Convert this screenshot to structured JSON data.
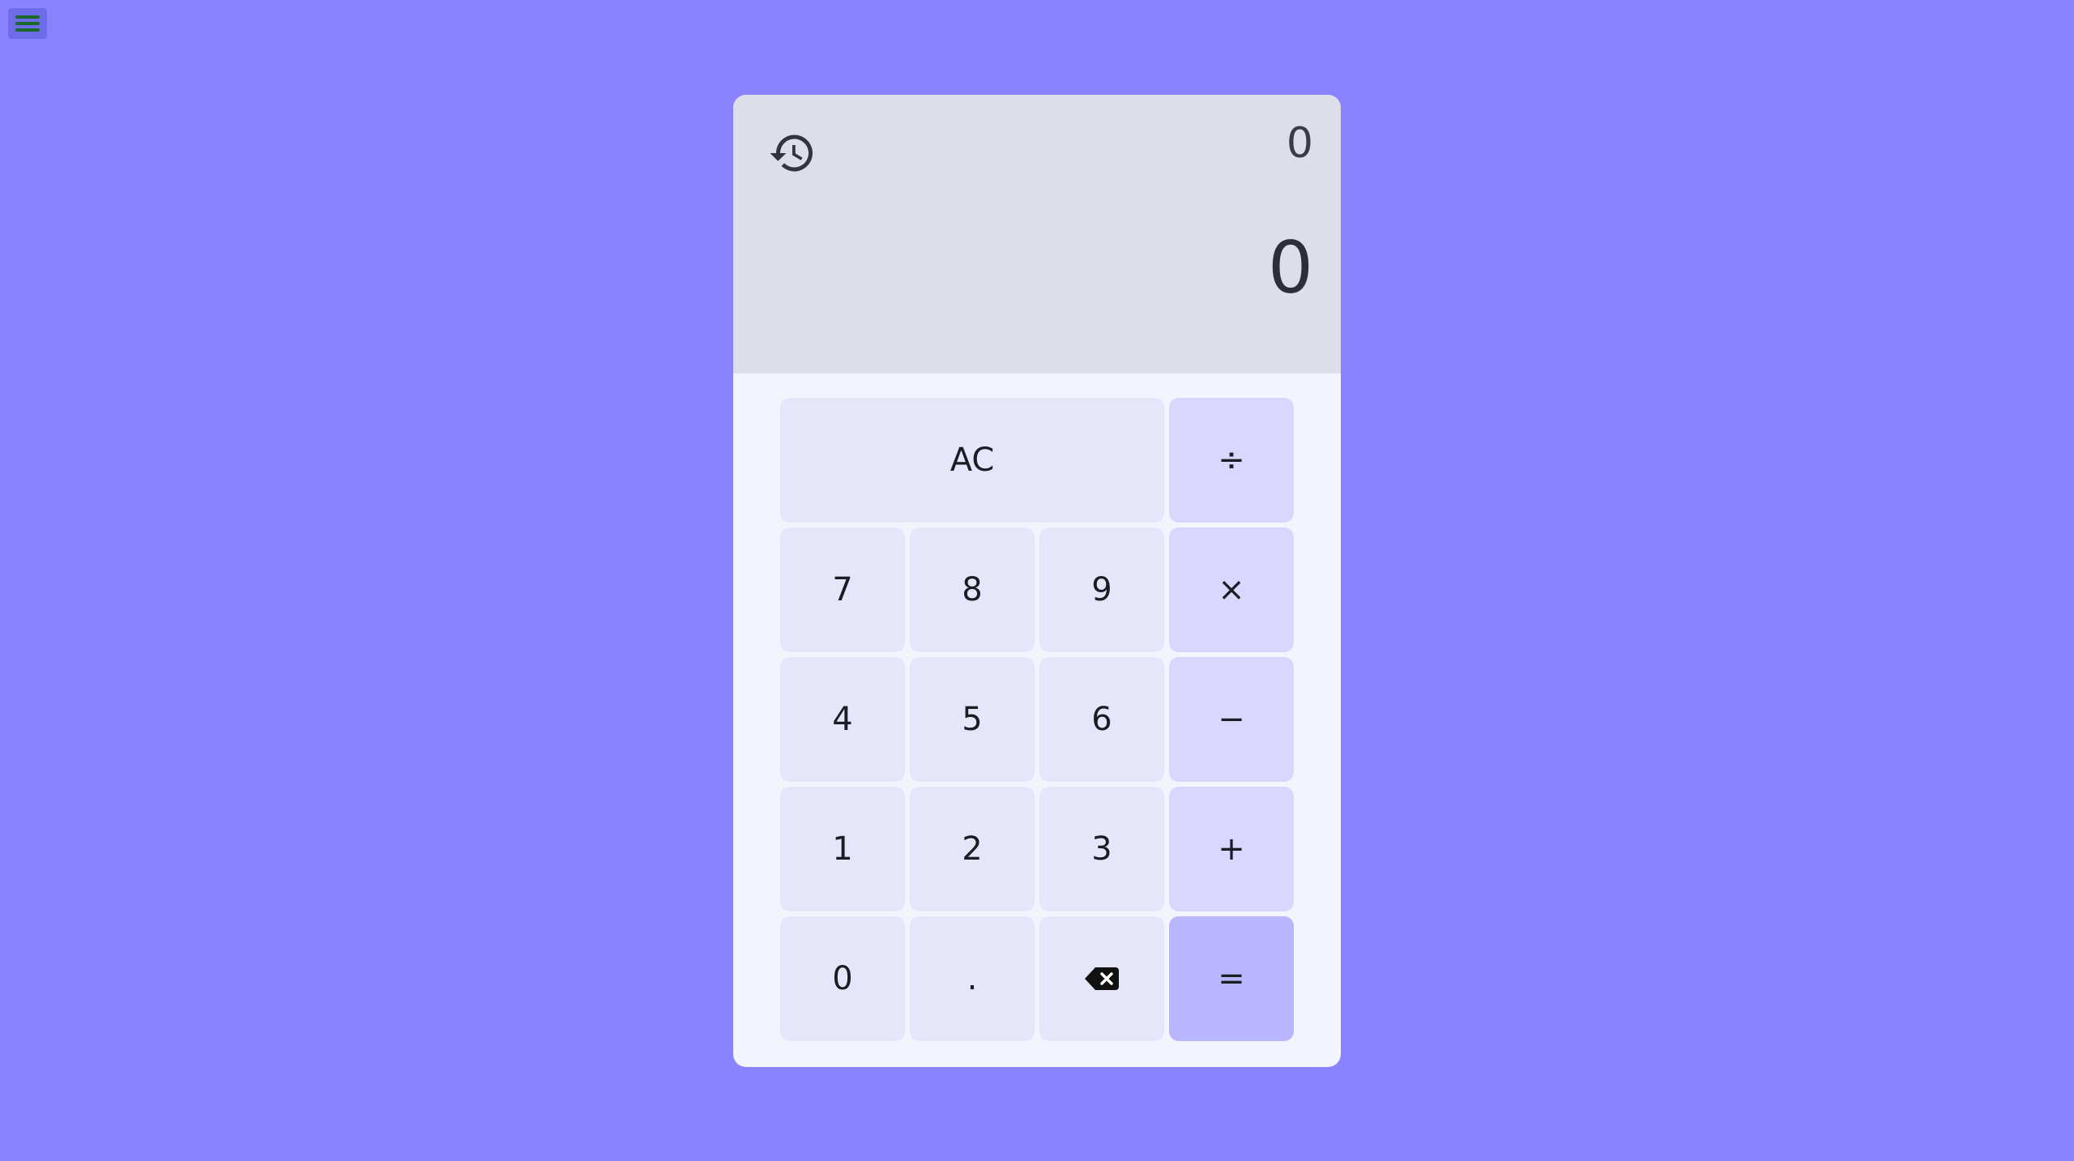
{
  "app": {
    "menu_icon": "hamburger-menu-icon",
    "menu_icon_color": "#1a6b2a"
  },
  "display": {
    "history_icon": "history-icon",
    "expression": "0",
    "result": "0"
  },
  "keys": {
    "clear": "AC",
    "divide": "÷",
    "seven": "7",
    "eight": "8",
    "nine": "9",
    "multiply": "×",
    "four": "4",
    "five": "5",
    "six": "6",
    "subtract": "−",
    "one": "1",
    "two": "2",
    "three": "3",
    "add": "+",
    "zero": "0",
    "decimal": ".",
    "backspace_icon": "backspace-icon",
    "equals": "="
  },
  "colors": {
    "background": "#8884ff",
    "display": "#dedeea",
    "keypad": "#f4f4fe",
    "digit_key": "#e6e6fb",
    "operator_key": "#d9d7fd",
    "equals_key": "#b9b6fd"
  }
}
